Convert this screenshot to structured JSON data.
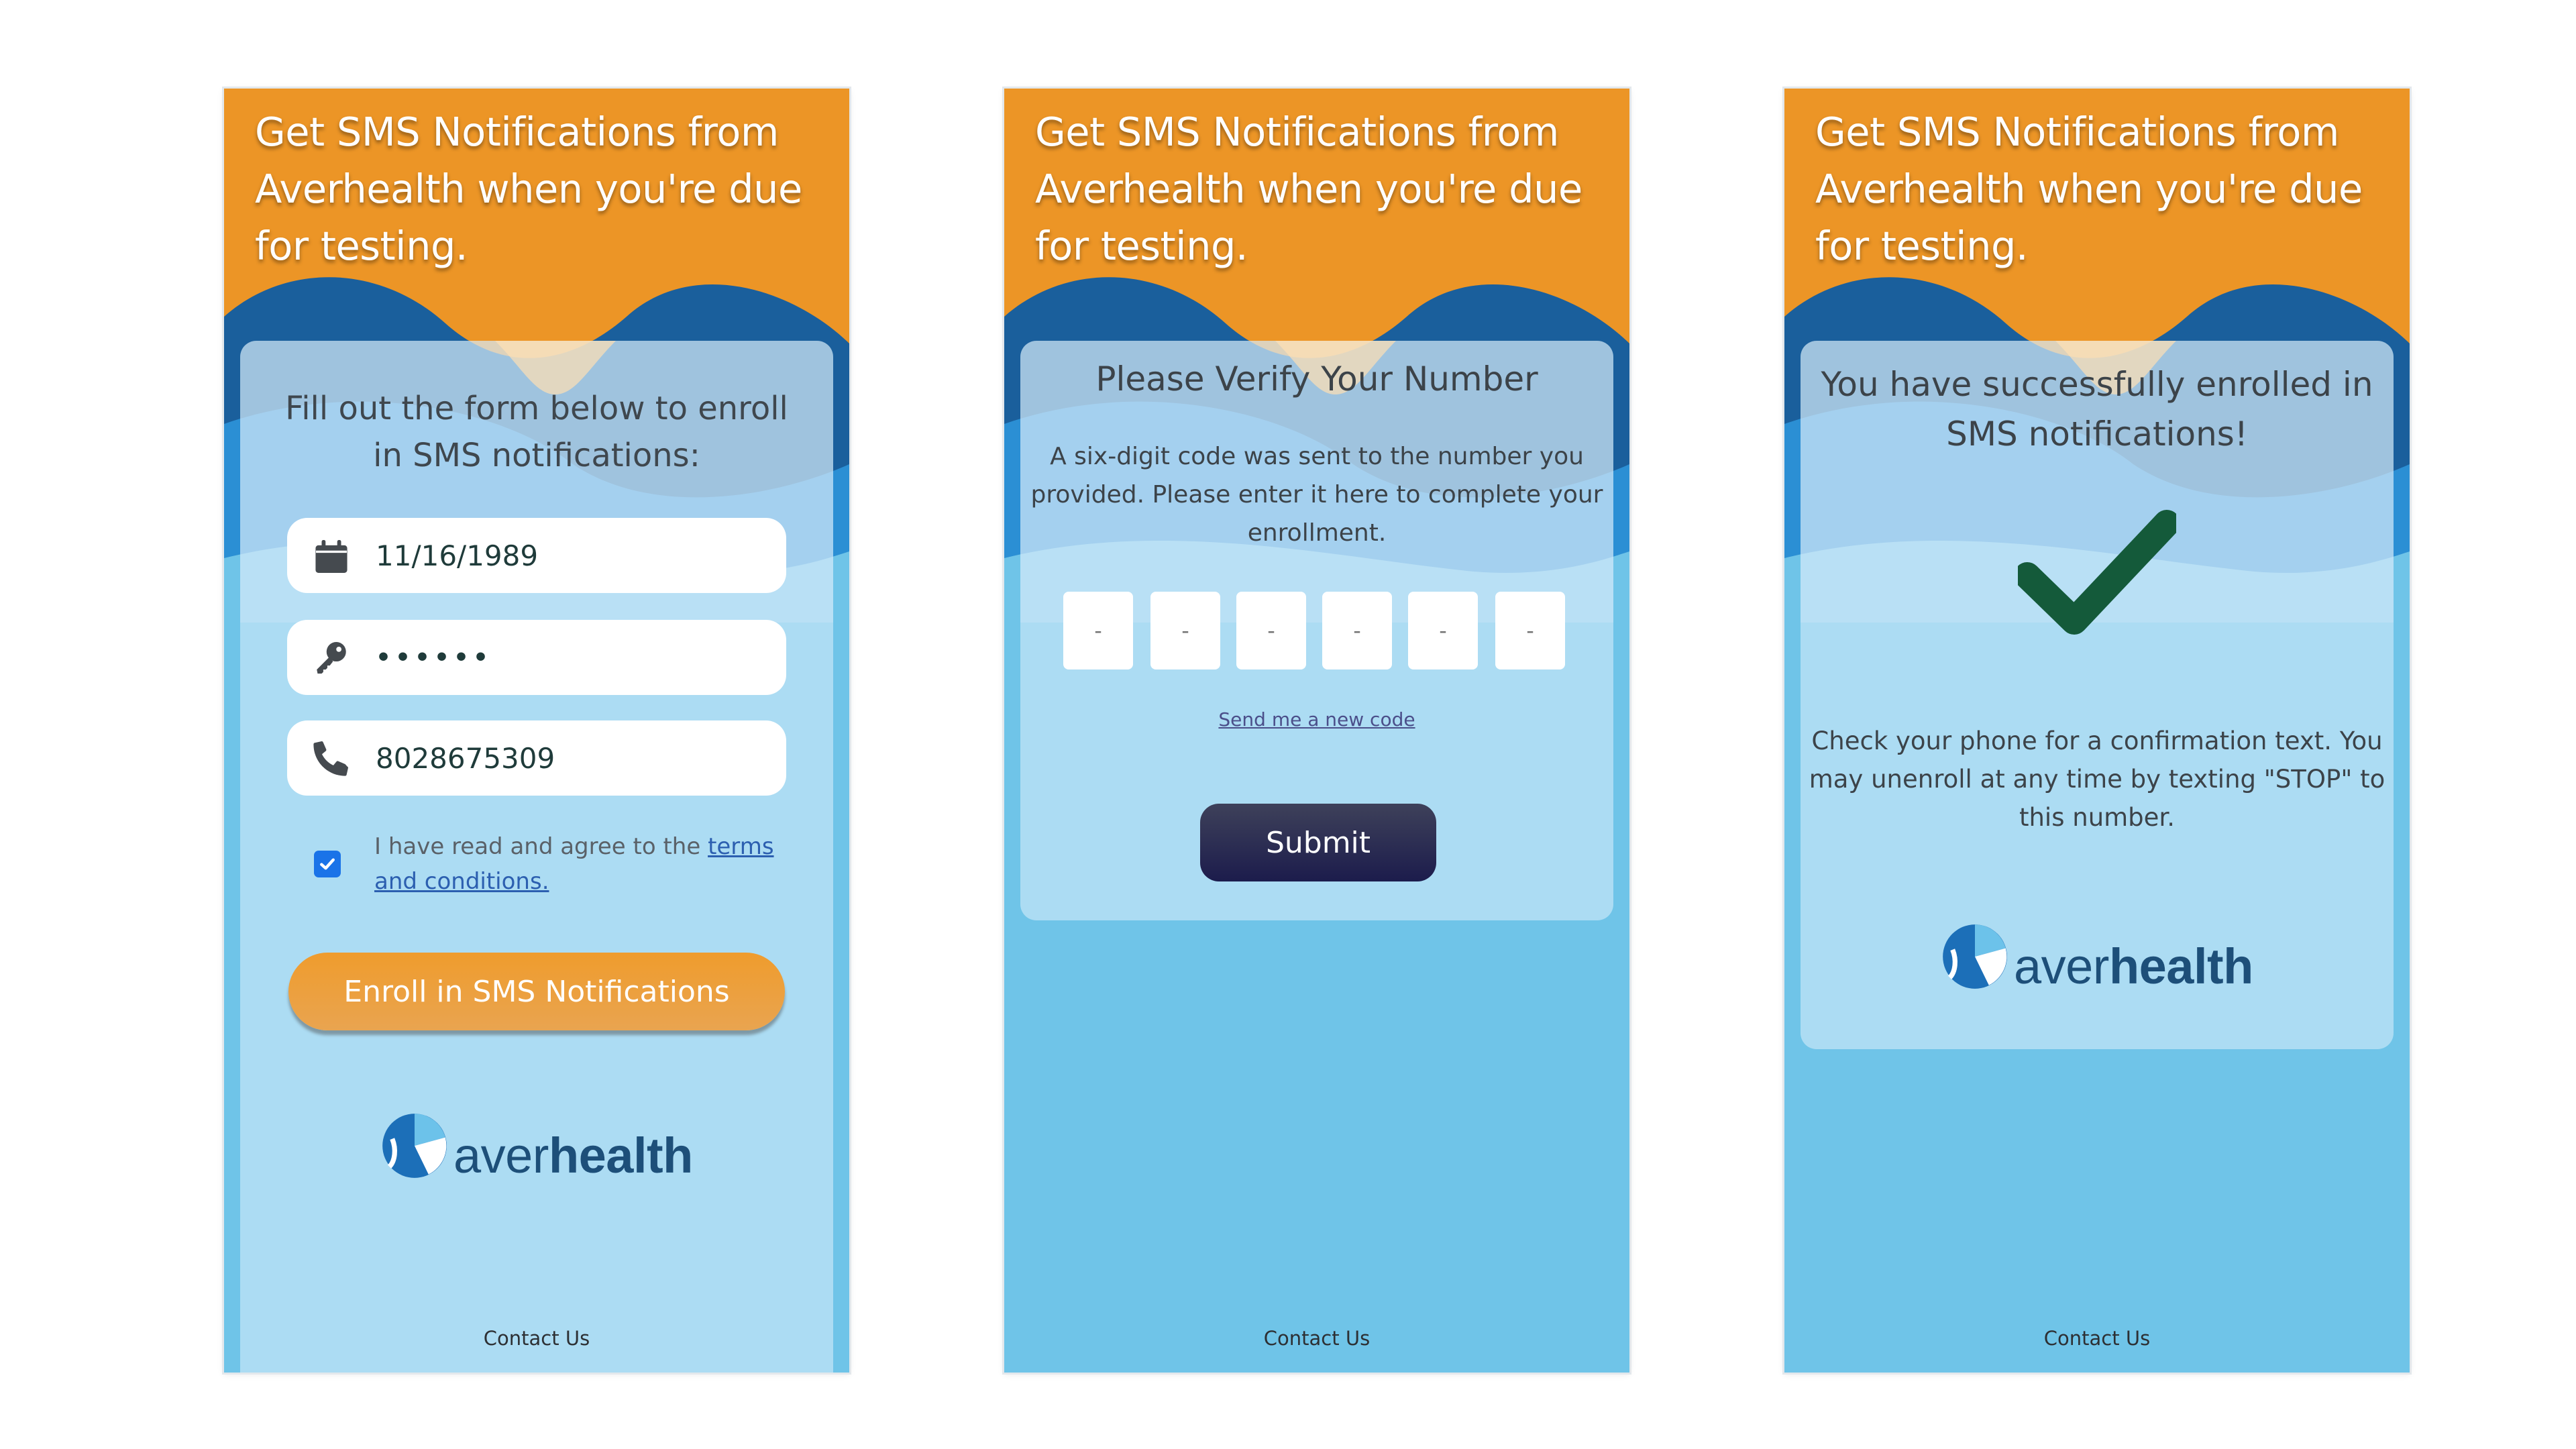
{
  "header": {
    "title": "Get SMS Notifications from Averhealth when you're due for testing."
  },
  "enroll_screen": {
    "heading": "Fill out the form below to enroll in SMS notifications:",
    "dob_value": "11/16/1989",
    "pin_value": "••••••",
    "phone_value": "8028675309",
    "terms_text": "I have read and agree to the ",
    "terms_link": "terms and conditions.",
    "terms_checked": true,
    "enroll_button": "Enroll in SMS Notifications"
  },
  "verify_screen": {
    "title": "Please Verify Your Number",
    "text": "A six-digit code was sent to the number you provided. Please enter it here to complete your enrollment.",
    "code_placeholder": "-",
    "resend_link": "Send me a new code",
    "submit_button": "Submit"
  },
  "success_screen": {
    "title": "You have successfully enrolled in SMS notifications!",
    "text": "Check your phone for a confirmation text. You may unenroll at any time by texting \"STOP\" to this number."
  },
  "logo": {
    "word_light": "aver",
    "word_bold": "health"
  },
  "footer": {
    "contact": "Contact Us"
  },
  "icons": [
    "calendar-icon",
    "key-icon",
    "phone-icon",
    "checkmark-icon",
    "averhealth-logo-icon"
  ],
  "colors": {
    "header_orange": "#ec9526",
    "wave_dark_blue": "#1a5f9c",
    "background_blue": "#6fc4e8",
    "checkmark_green": "#145a3a",
    "submit_navy": "#1c1c4c",
    "logo_blue": "#1d4f79"
  }
}
